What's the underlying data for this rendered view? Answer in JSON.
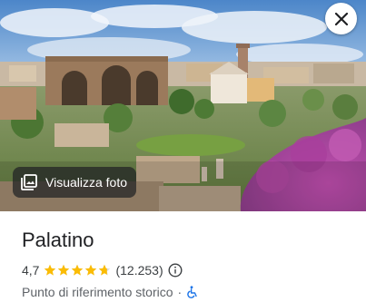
{
  "photo": {
    "view_photos_label": "Visualizza foto",
    "close_icon": "close-icon",
    "photos_icon": "photo-library-icon"
  },
  "place": {
    "name": "Palatino",
    "rating": "4,7",
    "rating_value": 4.7,
    "review_count": "(12.253)",
    "info_icon": "info-icon",
    "category": "Punto di riferimento storico",
    "separator": "·",
    "accessibility_icon": "wheelchair-icon"
  },
  "colors": {
    "star": "#fbbc04",
    "star_empty": "#dadce0",
    "accessible": "#1a73e8"
  }
}
